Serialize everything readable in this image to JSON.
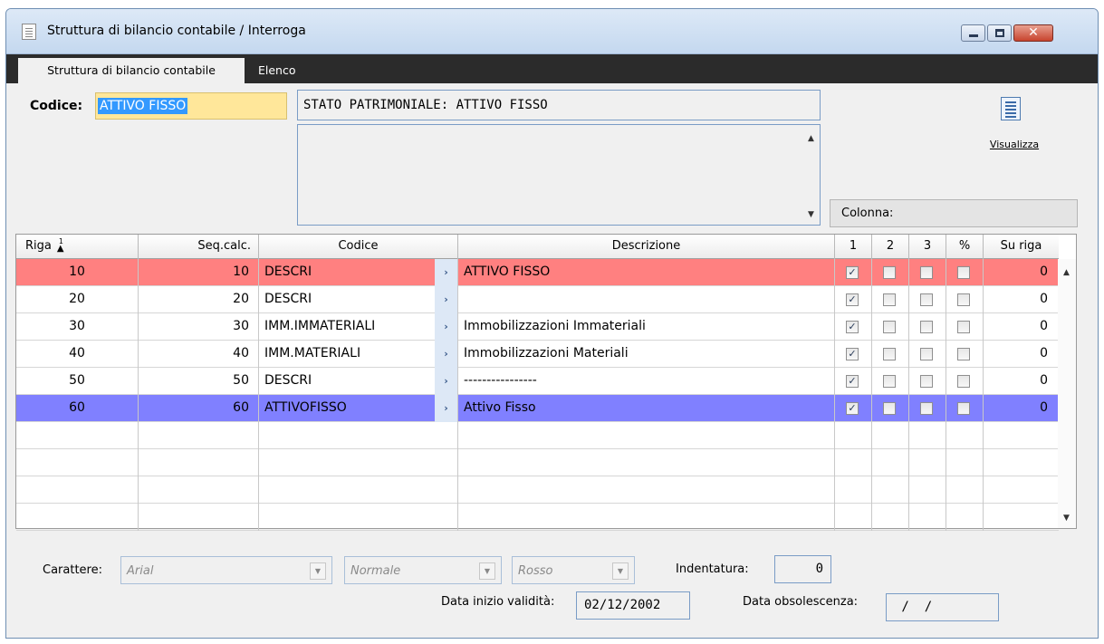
{
  "window": {
    "title": "Struttura di bilancio contabile / Interroga",
    "minimize_glyph": "",
    "close_glyph": "✕"
  },
  "tabs": [
    {
      "label": "Struttura di bilancio contabile",
      "active": true
    },
    {
      "label": "Elenco",
      "active": false
    }
  ],
  "header": {
    "codice_label": "Codice:",
    "codice_value": "ATTIVO FISSO",
    "descrizione_value": "STATO PATRIMONIALE: ATTIVO FISSO",
    "visualizza_label": "Visualizza",
    "colonna_label": "Colonna:"
  },
  "grid": {
    "columns": [
      "Riga",
      "Seq.calc.",
      "Codice",
      "Descrizione",
      "1",
      "2",
      "3",
      "%",
      "Su riga"
    ],
    "sort_indicator": "1",
    "rows": [
      {
        "riga": "10",
        "seq": "10",
        "codice": "DESCRI",
        "descrizione": "ATTIVO FISSO",
        "c1": true,
        "c2": false,
        "c3": false,
        "pct": false,
        "su_riga": "0",
        "highlight": "red"
      },
      {
        "riga": "20",
        "seq": "20",
        "codice": "DESCRI",
        "descrizione": "",
        "c1": true,
        "c2": false,
        "c3": false,
        "pct": false,
        "su_riga": "0",
        "highlight": ""
      },
      {
        "riga": "30",
        "seq": "30",
        "codice": "IMM.IMMATERIALI",
        "descrizione": "Immobilizzazioni Immateriali",
        "c1": true,
        "c2": false,
        "c3": false,
        "pct": false,
        "su_riga": "0",
        "highlight": ""
      },
      {
        "riga": "40",
        "seq": "40",
        "codice": "IMM.MATERIALI",
        "descrizione": "Immobilizzazioni Materiali",
        "c1": true,
        "c2": false,
        "c3": false,
        "pct": false,
        "su_riga": "0",
        "highlight": ""
      },
      {
        "riga": "50",
        "seq": "50",
        "codice": "DESCRI",
        "descrizione": "----------------",
        "c1": true,
        "c2": false,
        "c3": false,
        "pct": false,
        "su_riga": "0",
        "highlight": ""
      },
      {
        "riga": "60",
        "seq": "60",
        "codice": "ATTIVOFISSO",
        "descrizione": "Attivo Fisso",
        "c1": true,
        "c2": false,
        "c3": false,
        "pct": false,
        "su_riga": "0",
        "highlight": "blue"
      }
    ],
    "empty_rows": 4,
    "zoom_glyph": "›",
    "check_glyph": "✓"
  },
  "footer": {
    "carattere_label": "Carattere:",
    "font_value": "Arial",
    "style_value": "Normale",
    "color_value": "Rosso",
    "indentatura_label": "Indentatura:",
    "indentatura_value": "0",
    "data_inizio_label": "Data inizio validità:",
    "data_inizio_value": "02/12/2002",
    "data_obsolescenza_label": "Data obsolescenza:",
    "data_obsolescenza_value": " /  /"
  },
  "colors": {
    "row_red": "#ff8080",
    "row_blue": "#8080ff",
    "codice_bg": "#ffe79a",
    "selection": "#3399ff"
  }
}
